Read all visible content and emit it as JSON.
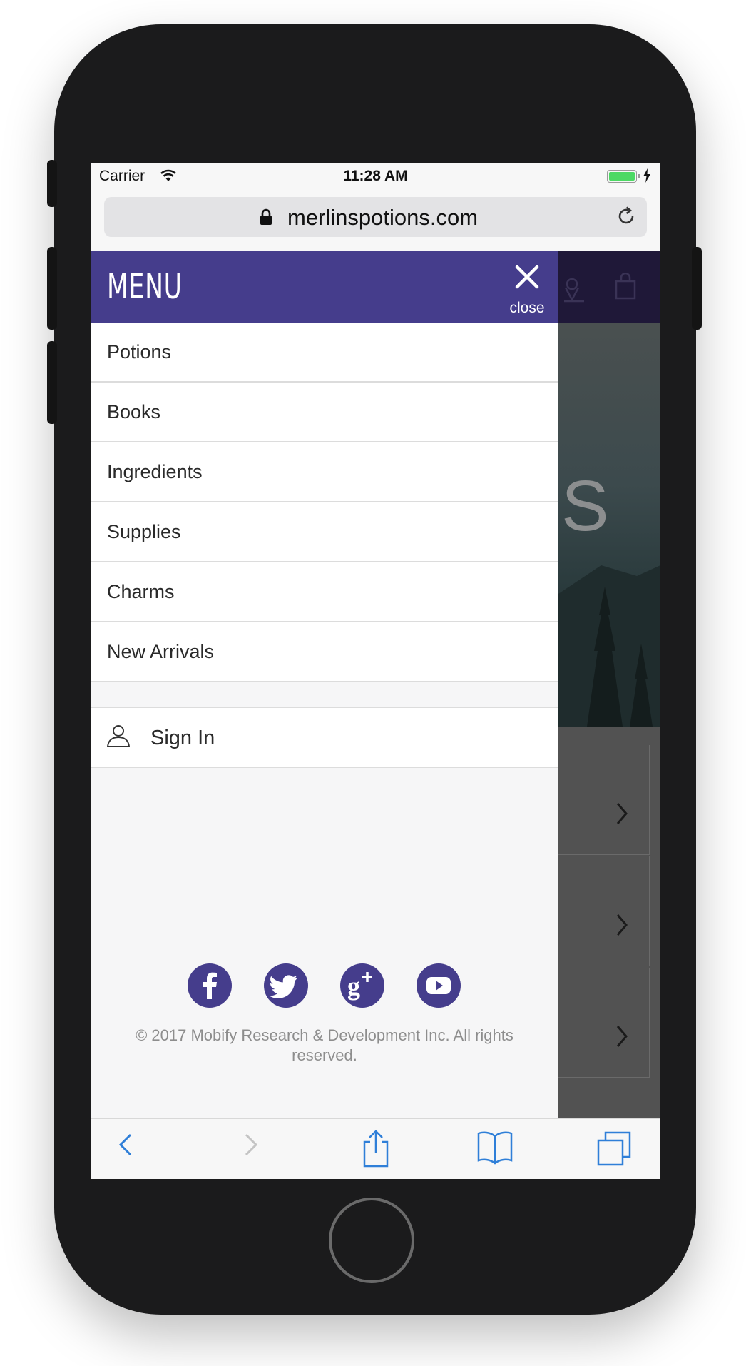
{
  "status_bar": {
    "carrier": "Carrier",
    "time": "11:28 AM",
    "battery_level": 1.0
  },
  "browser": {
    "url": "merlinspotions.com"
  },
  "menu": {
    "title": "MENU",
    "close_label": "close",
    "items": [
      {
        "label": "Potions"
      },
      {
        "label": "Books"
      },
      {
        "label": "Ingredients"
      },
      {
        "label": "Supplies"
      },
      {
        "label": "Charms"
      },
      {
        "label": "New Arrivals"
      }
    ],
    "sign_in": "Sign In"
  },
  "social": [
    "facebook-icon",
    "twitter-icon",
    "google-plus-icon",
    "youtube-icon"
  ],
  "footer": {
    "copyright": "© 2017 Mobify Research & Development Inc. All rights reserved."
  },
  "colors": {
    "brand": "#453d8c",
    "drawer_bg": "#f6f6f7",
    "ios_blue": "#2f7fd8"
  }
}
